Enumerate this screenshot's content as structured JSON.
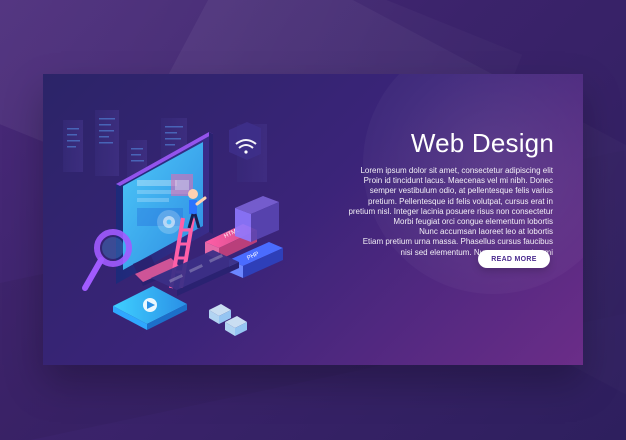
{
  "hero": {
    "title": "Web Design",
    "body_lines": [
      "Lorem ipsum dolor sit amet, consectetur adipiscing elit",
      "Proin id tincidunt lacus. Maecenas vel mi nibh. Donec",
      "semper vestibulum odio, at pellentesque felis varius",
      "pretium. Pellentesque id felis volutpat, cursus erat in",
      "pretium nisl. Integer lacinia posuere risus non consectetur",
      "Morbi feugiat orci congue elementum lobortis",
      "Nunc accumsan laoreet leo at lobortis",
      "Etiam pretium urna massa. Phasellus cursus faucibus",
      "nisi sed elementum. Nunc cursus metus mi"
    ],
    "button_label": "READ MORE"
  },
  "illustration": {
    "book_labels": [
      "HTML",
      "PHP"
    ],
    "icons": [
      "wifi-icon",
      "folder-icon",
      "magnifier-icon",
      "gear-icon",
      "play-icon",
      "ladder-icon",
      "person-icon",
      "book-icon",
      "keyboard-icon",
      "smartphone-icon",
      "cursor-icon"
    ]
  },
  "colors": {
    "background": "#3b236b",
    "card_start": "#2b2468",
    "card_end": "#6b2d88",
    "text": "#ffffff",
    "button_text": "#4a2a8f",
    "accent_pink": "#e74c8a",
    "accent_blue": "#4fc1ff"
  }
}
